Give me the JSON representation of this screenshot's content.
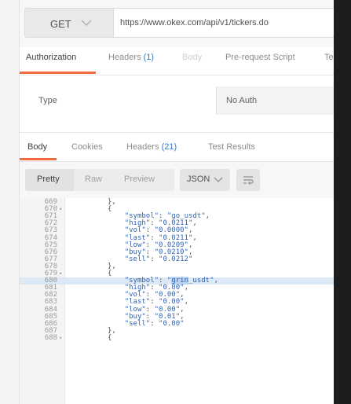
{
  "request": {
    "method": "GET",
    "url": "https://www.okex.com/api/v1/tickers.do"
  },
  "request_tabs": [
    {
      "label": "Authorization",
      "count": ""
    },
    {
      "label": "Headers",
      "count": "(1)"
    },
    {
      "label": "Body",
      "count": ""
    },
    {
      "label": "Pre-request Script",
      "count": ""
    },
    {
      "label": "Te",
      "count": ""
    }
  ],
  "auth": {
    "type_label": "Type",
    "type_value": "No Auth"
  },
  "response_tabs": [
    {
      "label": "Body",
      "count": ""
    },
    {
      "label": "Cookies",
      "count": ""
    },
    {
      "label": "Headers",
      "count": "(21)"
    },
    {
      "label": "Test Results",
      "count": ""
    }
  ],
  "response_toolbar": {
    "views": [
      "Pretty",
      "Raw",
      "Preview"
    ],
    "format": "JSON"
  },
  "code": {
    "highlight": "grin",
    "lines": [
      {
        "n": "669",
        "fold": "",
        "text": "},"
      },
      {
        "n": "670",
        "fold": "▾",
        "text": "{"
      },
      {
        "n": "671",
        "fold": "",
        "text": "    \"symbol\": \"go_usdt\","
      },
      {
        "n": "672",
        "fold": "",
        "text": "    \"high\": \"0.0211\","
      },
      {
        "n": "673",
        "fold": "",
        "text": "    \"vol\": \"0.0000\","
      },
      {
        "n": "674",
        "fold": "",
        "text": "    \"last\": \"0.0211\","
      },
      {
        "n": "675",
        "fold": "",
        "text": "    \"low\": \"0.0209\","
      },
      {
        "n": "676",
        "fold": "",
        "text": "    \"buy\": \"0.0210\","
      },
      {
        "n": "677",
        "fold": "",
        "text": "    \"sell\": \"0.0212\""
      },
      {
        "n": "678",
        "fold": "",
        "text": "},"
      },
      {
        "n": "679",
        "fold": "▾",
        "text": "{"
      },
      {
        "n": "680",
        "fold": "",
        "text": "    \"symbol\": \"grin_usdt\",",
        "highlighted": true
      },
      {
        "n": "681",
        "fold": "",
        "text": "    \"high\": \"0.00\","
      },
      {
        "n": "682",
        "fold": "",
        "text": "    \"vol\": \"0.00\","
      },
      {
        "n": "683",
        "fold": "",
        "text": "    \"last\": \"0.00\","
      },
      {
        "n": "684",
        "fold": "",
        "text": "    \"low\": \"0.00\","
      },
      {
        "n": "685",
        "fold": "",
        "text": "    \"buy\": \"0.01\","
      },
      {
        "n": "686",
        "fold": "",
        "text": "    \"sell\": \"0.00\""
      },
      {
        "n": "687",
        "fold": "",
        "text": "},"
      },
      {
        "n": "688",
        "fold": "▾",
        "text": "{"
      }
    ]
  },
  "colors": {
    "accent": "#f26b3a",
    "count": "#2c7bd4",
    "json": "#2f62b3",
    "line_highlight": "#dce8f6"
  },
  "icons": [
    "chevron-down-icon",
    "wrap-lines-icon",
    "fold-arrow-icon"
  ]
}
